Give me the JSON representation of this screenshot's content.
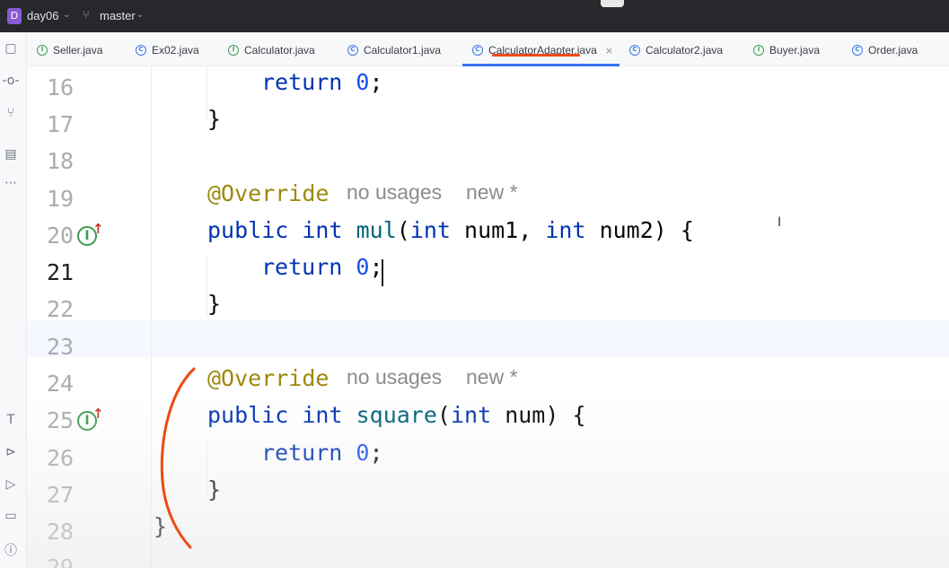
{
  "titlebar": {
    "project_badge": "D",
    "project_name": "day06",
    "branch_name": "master"
  },
  "tabs": [
    {
      "label": "Seller.java",
      "icon": "interface-icon"
    },
    {
      "label": "Ex02.java",
      "icon": "class-icon"
    },
    {
      "label": "Calculator.java",
      "icon": "interface-icon"
    },
    {
      "label": "Calculator1.java",
      "icon": "class-icon"
    },
    {
      "label": "CalculatorAdapter.java",
      "icon": "class-icon",
      "active": true
    },
    {
      "label": "Calculator2.java",
      "icon": "class-icon"
    },
    {
      "label": "Buyer.java",
      "icon": "interface-icon"
    },
    {
      "label": "Order.java",
      "icon": "class-icon"
    }
  ],
  "tab_close_glyph": "×",
  "annotation_colors": {
    "pen_stroke": "#ef4a12",
    "active_tab_underline": "#3574f0"
  },
  "editor": {
    "current_line": "21",
    "lines": [
      {
        "n": "16",
        "text": "return 0;"
      },
      {
        "n": "17",
        "text": "}"
      },
      {
        "n": "18",
        "text": ""
      },
      {
        "n": "19",
        "annotation": "@Override",
        "hint_usages": "no usages",
        "hint_new": "new *"
      },
      {
        "n": "20",
        "text": "public int mul(int num1, int num2) {"
      },
      {
        "n": "21",
        "text": "return 0;"
      },
      {
        "n": "22",
        "text": "}"
      },
      {
        "n": "23",
        "text": ""
      },
      {
        "n": "24",
        "annotation": "@Override",
        "hint_usages": "no usages",
        "hint_new": "new *"
      },
      {
        "n": "25",
        "text": "public int square(int num) {"
      },
      {
        "n": "26",
        "text": "return 0;"
      },
      {
        "n": "27",
        "text": "}"
      },
      {
        "n": "28",
        "text": "}"
      },
      {
        "n": "29",
        "text": ""
      }
    ],
    "tokens": {
      "kw_return": "return",
      "num_zero": "0",
      "semi": ";",
      "brace_close": "}",
      "kw_public": "public",
      "kw_int": "int",
      "fn_mul": "mul",
      "fn_square": "square",
      "param_num1": "num1",
      "param_num2": "num2",
      "param_num": "num",
      "open_brace": "{"
    },
    "gutter_icon_label": "I",
    "gutter_arrow": "↑"
  }
}
